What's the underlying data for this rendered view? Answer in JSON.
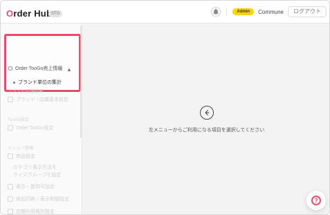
{
  "app": {
    "brand": "Order Hub",
    "env_badge": "STG"
  },
  "header": {
    "admin_badge": "Admin",
    "org_name": "Commune",
    "logout_label": "ログアウト"
  },
  "sidebar": {
    "section_1": "",
    "menu_group_label": "Order TooGo売上情報",
    "menu_sub_item": "ブランド単位の集計",
    "faded_items": [
      {
        "section": "ブランド/店舗情報",
        "label": "ブランド / 店舗基本設定"
      },
      {
        "section": "TooGo設定",
        "label": "Order TooGo設定"
      },
      {
        "section": "メニュー情報",
        "label": "商品設定"
      },
      {
        "section": "",
        "label": "カテゴリ表示方法を"
      },
      {
        "section": "",
        "label": "サイズグループを設定"
      },
      {
        "section": "",
        "label": "表示・提供可設定"
      },
      {
        "section": "",
        "label": "商品印刷・表示制御設定"
      },
      {
        "section": "",
        "label": "店舗利用権利設定"
      }
    ]
  },
  "main": {
    "hint": "左メニューからご利用になる項目を選択してください"
  },
  "help": {
    "icon": "help-icon"
  }
}
